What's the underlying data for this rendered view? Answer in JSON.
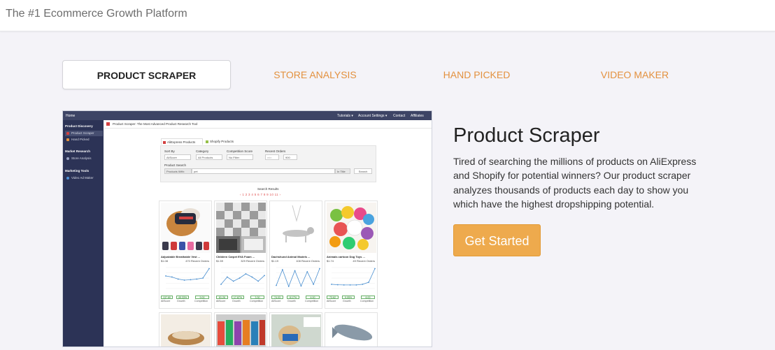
{
  "header": {
    "tagline": "The #1 Ecommerce Growth Platform"
  },
  "tabs": [
    {
      "label": "PRODUCT SCRAPER",
      "active": true
    },
    {
      "label": "STORE ANALYSIS",
      "active": false
    },
    {
      "label": "HAND PICKED",
      "active": false
    },
    {
      "label": "VIDEO MAKER",
      "active": false
    }
  ],
  "screenshot": {
    "nav": {
      "home": "Home",
      "tutorials": "Tutorials ▾",
      "account": "Account Settings ▾",
      "contact": "Contact",
      "affiliates": "Affiliates"
    },
    "sidebar": {
      "section1": "Product Discovery",
      "item_scraper": "Product Scraper",
      "item_handpicked": "Hand Picked",
      "section2": "Market Research",
      "item_store": "Store Analysis",
      "section3": "Marketing Tools",
      "item_video": "Video Ad Maker"
    },
    "page_header": "Product Scraper: The Most Advanced Product Research Tool",
    "source_tabs": {
      "aliexpress": "AliExpress Products",
      "shopify": "Shopify Products"
    },
    "form": {
      "sort_label": "Sort By",
      "sort_value": "AliScore",
      "category_label": "Category",
      "category_value": "All Products",
      "competition_label": "Competition Score",
      "competition_value": "No Filter",
      "orders_label": "Recent Orders",
      "orders_min": "min",
      "orders_max": "900",
      "search_label": "Product Search",
      "products_with": "Products With:",
      "search_value": "pet",
      "in_title": "In Title",
      "search_button": "Search"
    },
    "results_label": "Search Results",
    "pagination": "‹ 1 2 3 4 5 6 7 8 9 10 11 ›",
    "products": [
      {
        "title": "Adjustable Breathable Vest ...",
        "price": "$1.08",
        "orders": "470 Recent Orders",
        "aliscore": "137.80",
        "growth": "45.33%",
        "competition": "9.00",
        "trend": [
          0.6,
          0.55,
          0.45,
          0.4,
          0.42,
          0.45,
          0.5,
          0.95
        ]
      },
      {
        "title": "Children Carpet EVA Foam ...",
        "price": "$1.59",
        "orders": "329 Recent Orders",
        "aliscore": "81.26",
        "growth": "17.87%",
        "competition": "3.30",
        "trend": [
          0.2,
          0.55,
          0.35,
          0.5,
          0.7,
          0.55,
          0.35,
          0.62
        ]
      },
      {
        "title": "Dachshund Animal Models ...",
        "price": "$1.19",
        "orders": "108 Recent Orders",
        "aliscore": "74.03",
        "growth": "8.17%",
        "competition": "4.00",
        "trend": [
          0.15,
          0.9,
          0.1,
          0.85,
          0.12,
          0.8,
          0.2,
          0.95
        ]
      },
      {
        "title": "Animals cartoon Dog Toys ...",
        "price": "$1.74",
        "orders": "49 Recent Orders",
        "aliscore": "73.62",
        "growth": "9.05%",
        "competition": "6.00",
        "trend": [
          0.2,
          0.18,
          0.17,
          0.17,
          0.17,
          0.2,
          0.3,
          0.95
        ]
      }
    ],
    "stat_labels": {
      "aliscore": "AliScore",
      "growth": "Growth",
      "competition": "Competition"
    }
  },
  "product": {
    "title": "Product Scraper",
    "description": "Tired of searching the millions of products on AliExpress and Shopify for potential winners? Our product scraper analyzes thousands of products each day to show you which have the highest dropshipping potential.",
    "cta": "Get Started"
  },
  "colors": {
    "accent": "#eeaa4d",
    "tab_text": "#e3913f",
    "nav_dark": "#2c3356"
  }
}
